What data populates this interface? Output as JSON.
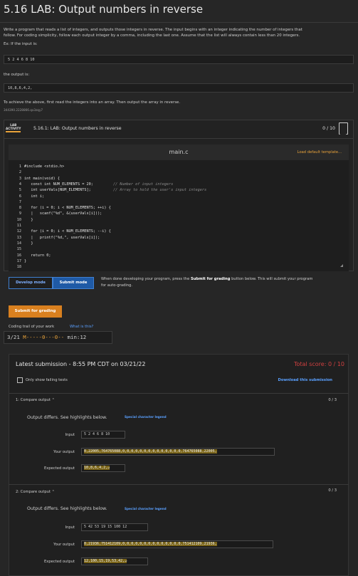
{
  "page": {
    "title": "5.16 LAB: Output numbers in reverse",
    "desc1": "Write a program that reads a list of integers, and outputs those integers in reverse. The input begins with an integer indicating the number of integers that",
    "desc2": "follow. For coding simplicity, follow each output integer by a comma, including the last one. Assume that the list will always contain less than 20 integers.",
    "ex_input_label": "Ex: If the input is:",
    "ex_input": "5 2 4 6 8 10",
    "ex_output_label": "the output is:",
    "ex_output": "10,8,6,4,2,",
    "achieve": "To achieve the above, first read the integers into an array. Then output the array in reverse.",
    "id_code": "344390.2228866.qx3zqy7"
  },
  "lab": {
    "tag_line1": "LAB",
    "tag_line2": "ACTIVITY",
    "title": "5.16.1: LAB: Output numbers in reverse",
    "score": "0 / 10"
  },
  "editor": {
    "filename": "main.c",
    "load_template": "Load default template...",
    "lines": [
      {
        "n": "1",
        "text": "#include <stdio.h>"
      },
      {
        "n": "2",
        "text": ""
      },
      {
        "n": "3",
        "text": "int main(void) {"
      },
      {
        "n": "4",
        "text": "   const int NUM_ELEMENTS = 20;         // Number of input integers"
      },
      {
        "n": "5",
        "text": "   int userVals[NUM_ELEMENTS];          // Array to hold the user's input integers"
      },
      {
        "n": "6",
        "text": "   int i;"
      },
      {
        "n": "7",
        "text": ""
      },
      {
        "n": "8",
        "text": "   for (i = 0; i < NUM_ELEMENTS; ++i) {"
      },
      {
        "n": "9",
        "text": "   |   scanf(\"%d\", &(userVals[i]));"
      },
      {
        "n": "10",
        "text": "   }"
      },
      {
        "n": "11",
        "text": ""
      },
      {
        "n": "12",
        "text": "   for (i = 0; i < NUM_ELEMENTS; --i) {"
      },
      {
        "n": "13",
        "text": "   |   printf(\"%d,\", userVals[i]);"
      },
      {
        "n": "14",
        "text": "   }"
      },
      {
        "n": "15",
        "text": ""
      },
      {
        "n": "16",
        "text": "   return 0;"
      },
      {
        "n": "17",
        "text": "}"
      },
      {
        "n": "18",
        "text": ""
      }
    ]
  },
  "modes": {
    "develop": "Develop mode",
    "submit": "Submit mode",
    "info_prefix": "When done developing your program, press the ",
    "info_bold": "Submit for grading",
    "info_suffix": " button below. This will submit your program",
    "info_line2": "for auto-grading."
  },
  "submit_btn": "Submit for grading",
  "trail": {
    "label": "Coding trail of your work",
    "link": "What is this?",
    "value_prefix": "3/21 ",
    "value_marks": "M-----0---0--",
    "value_suffix": " min:12"
  },
  "submission": {
    "latest": "Latest submission - 8:55 PM CDT on 03/21/22",
    "total": "Total score: 0 / 10",
    "only_failing": "Only show failing tests",
    "download": "Download this submission",
    "colors": {
      "total": "#d04040",
      "link": "#5aa0ff",
      "accent": "#e8a23a"
    },
    "tests": [
      {
        "header": "1: Compare output",
        "score": "0 / 3",
        "differs": "Output differs. See highlights below.",
        "legend": "Special character legend",
        "input_label": "Input",
        "input": "5 2 4 6 8 10",
        "your_label": "Your output",
        "your": "0,22005,764765088,0,0,0,0,0,0,0,0,0,0,0,0,0,0,764765088,22005,",
        "expected_label": "Expected output",
        "expected": "10,8,6,4,2,↵"
      },
      {
        "header": "2: Compare output",
        "score": "0 / 3",
        "differs": "Output differs. See highlights below.",
        "legend": "Special character legend",
        "input_label": "Input",
        "input": "5 42 53 19 15 100 12",
        "your_label": "Your output",
        "your": "0,21936,751412109,0,0,0,0,0,0,0,0,0,0,0,0,0,0,751412109,21936,",
        "expected_label": "Expected output",
        "expected": "12,100,15,19,53,42,↵"
      }
    ]
  }
}
